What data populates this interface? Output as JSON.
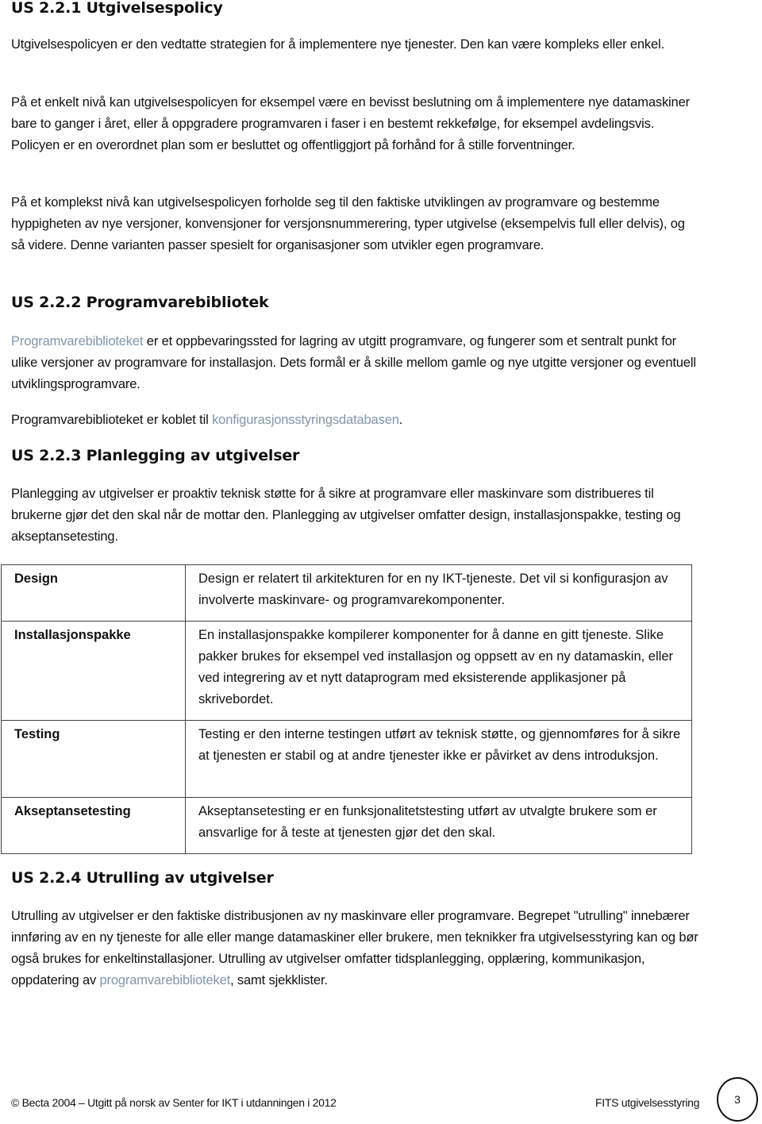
{
  "sections": {
    "s1": {
      "heading": "US 2.2.1 Utgivelsespolicy",
      "p1": "Utgivelsespolicyen er den vedtatte strategien for å implementere nye tjenester. Den kan være kompleks eller enkel.",
      "p2": "På et enkelt nivå kan utgivelsespolicyen for eksempel være en bevisst beslutning om å implementere nye datamaskiner bare to ganger i året, eller å oppgradere programvaren i faser i en bestemt rekkefølge, for eksempel avdelingsvis. Policyen er en overordnet plan som er besluttet og offentliggjort på forhånd for å stille forventninger.",
      "p3": "På et komplekst nivå kan utgivelsespolicyen forholde seg til den faktiske utviklingen av programvare og bestemme hyppigheten av nye versjoner, konvensjoner for versjonsnummerering, typer utgivelse (eksempelvis full eller delvis), og så videre. Denne varianten passer spesielt for organisasjoner som utvikler egen programvare."
    },
    "s2": {
      "heading": "US 2.2.2 Programvarebibliotek",
      "p1_link": "Programvarebiblioteket",
      "p1_rest": " er et oppbevaringssted for lagring av utgitt programvare, og fungerer som et sentralt punkt for ulike versjoner av programvare for installasjon. Dets formål er å skille mellom gamle og nye utgitte versjoner og eventuell utviklingsprogramvare.",
      "p2_start": "Programvarebiblioteket er koblet til ",
      "p2_link": "konfigurasjonsstyringsdatabasen",
      "p2_end": "."
    },
    "s3": {
      "heading": "US 2.2.3 Planlegging av utgivelser",
      "p1": "Planlegging av utgivelser er proaktiv teknisk støtte for å sikre at programvare eller maskinvare som distribueres til brukerne gjør det den skal når de mottar den. Planlegging av utgivelser omfatter design, installasjonspakke, testing og akseptansetesting.",
      "table": [
        {
          "term": "Design",
          "definition": "Design er relatert til arkitekturen for en ny IKT-tjeneste. Det vil si konfigurasjon av involverte maskinvare- og programvarekomponenter."
        },
        {
          "term": "Installasjonspakke",
          "definition": "En installasjonspakke kompilerer komponenter for å danne en gitt tjeneste. Slike pakker brukes for eksempel ved installasjon og oppsett av en ny datamaskin, eller ved integrering av et nytt dataprogram med eksisterende applikasjoner på skrivebordet."
        },
        {
          "term": "Testing",
          "definition": "Testing er den interne testingen utført av teknisk støtte, og gjennomføres for å sikre at tjenesten er stabil og at andre tjenester ikke er påvirket av dens introduksjon."
        },
        {
          "term": "Akseptansetesting",
          "definition": "Akseptansetesting er en funksjonalitetstesting utført av utvalgte brukere som er ansvarlige for å teste at tjenesten gjør det den skal."
        }
      ]
    },
    "s4": {
      "heading": "US 2.2.4 Utrulling av utgivelser",
      "p1_start": "Utrulling av utgivelser er den faktiske distribusjonen av ny maskinvare eller programvare. Begrepet \"utrulling\" innebærer innføring av en ny tjeneste for alle eller mange datamaskiner eller brukere, men teknikker fra utgivelsesstyring kan og bør også brukes for enkeltinstallasjoner. Utrulling av utgivelser omfatter tidsplanlegging, opplæring, kommunikasjon, oppdatering av ",
      "p1_link": "programvarebiblioteket",
      "p1_end": ", samt sjekklister."
    }
  },
  "footer": {
    "copyright": "© Becta 2004 – Utgitt på norsk av Senter for IKT i utdanningen i 2012",
    "doc_title": "FITS utgivelsesstyring",
    "page_number": "3"
  },
  "colors": {
    "link": "#7f96aa",
    "text": "#111111"
  }
}
